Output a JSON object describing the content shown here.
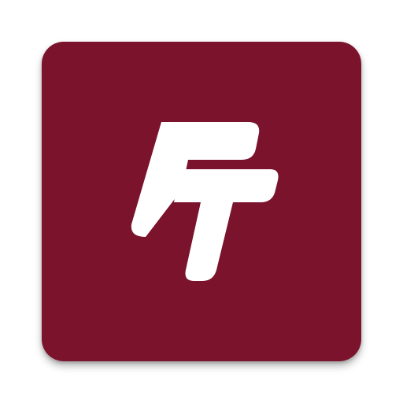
{
  "icon": {
    "name": "ft-logo-icon",
    "text": "FT",
    "background_color": "#7a132b",
    "glyph_color": "#ffffff"
  }
}
